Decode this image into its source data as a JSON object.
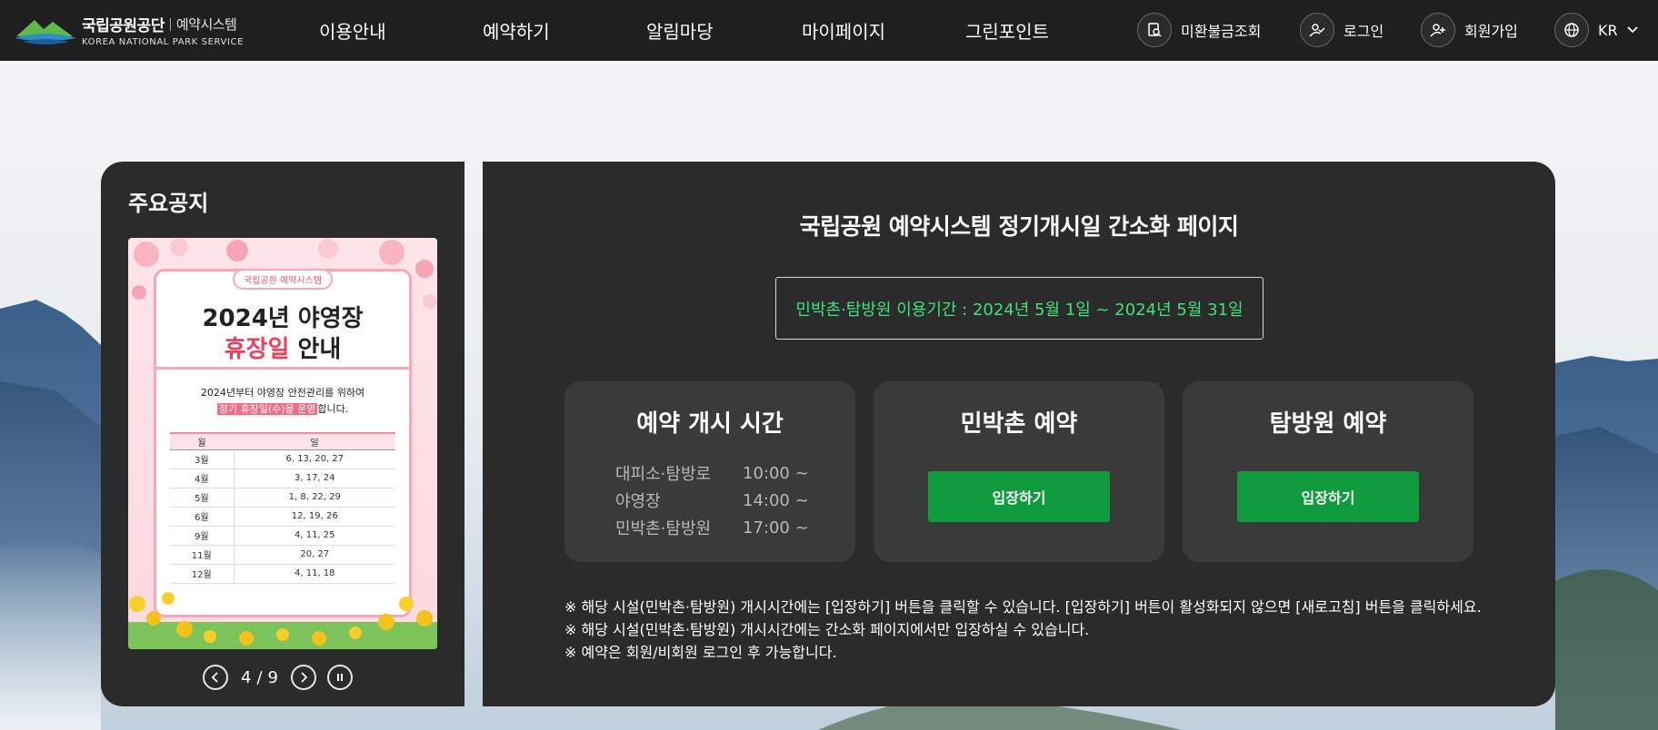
{
  "header": {
    "logo_name": "국립공원공단",
    "logo_system": "예약시스템",
    "logo_english": "KOREA NATIONAL PARK SERVICE",
    "nav": [
      "이용안내",
      "예약하기",
      "알림마당",
      "마이페이지",
      "그린포인트"
    ],
    "util": {
      "refund_label": "미환불금조회",
      "refund_icon": "search-document-icon",
      "login_label": "로그인",
      "login_icon": "user-check-icon",
      "join_label": "회원가입",
      "join_icon": "user-plus-icon",
      "lang_label": "KR",
      "lang_icon": "globe-icon"
    }
  },
  "notice": {
    "title": "주요공지",
    "poster": {
      "badge": "국립공원 예약시스템",
      "headline1": "2024년 야영장",
      "headline2_red": "휴장일",
      "headline2_rest": " 안내",
      "para1": "2024년부터 야영장 안전관리를 위하여",
      "para2_highlight": "정기 휴장일(수)을 운영",
      "para2_rest": "합니다.",
      "table_headers": [
        "월",
        "일"
      ],
      "table_rows": [
        [
          "3월",
          "6, 13, 20, 27"
        ],
        [
          "4월",
          "3, 17, 24"
        ],
        [
          "5월",
          "1, 8, 22, 29"
        ],
        [
          "6월",
          "12, 19, 26"
        ],
        [
          "9월",
          "4, 11, 25"
        ],
        [
          "11월",
          "20, 27"
        ],
        [
          "12월",
          "4, 11, 18"
        ]
      ]
    },
    "pager": {
      "current": "4",
      "separator": "/",
      "total": "9"
    }
  },
  "main": {
    "title": "국립공원 예약시스템 정기개시일 간소화 페이지",
    "period": "민박촌·탐방원 이용기간 : 2024년 5월 1일 ~ 2024년 5월 31일",
    "schedule_card": {
      "title": "예약 개시 시간",
      "rows": [
        {
          "name": "대피소·탐방로",
          "time": "10:00 ~"
        },
        {
          "name": "야영장",
          "time": "14:00 ~"
        },
        {
          "name": "민박촌·탐방원",
          "time": "17:00 ~"
        }
      ]
    },
    "minbak_card": {
      "title": "민박촌 예약",
      "button": "입장하기"
    },
    "tambang_card": {
      "title": "탐방원 예약",
      "button": "입장하기"
    },
    "notes": [
      "※ 해당 시설(민박촌·탐방원) 개시시간에는 [입장하기] 버튼을 클릭할 수 있습니다. [입장하기] 버튼이 활성화되지 않으면 [새로고침] 버튼을 클릭하세요.",
      "※ 해당 시설(민박촌·탐방원) 개시시간에는 간소화 페이지에서만 입장하실 수 있습니다.",
      "※ 예약은 회원/비회원 로그인 후 가능합니다."
    ]
  },
  "colors": {
    "header_bg": "#1f1f1f",
    "panel_bg": "#2b2b2b",
    "card_bg": "#3a3a3a",
    "accent_green": "#0f9b3e",
    "period_text": "#3ee37a"
  }
}
